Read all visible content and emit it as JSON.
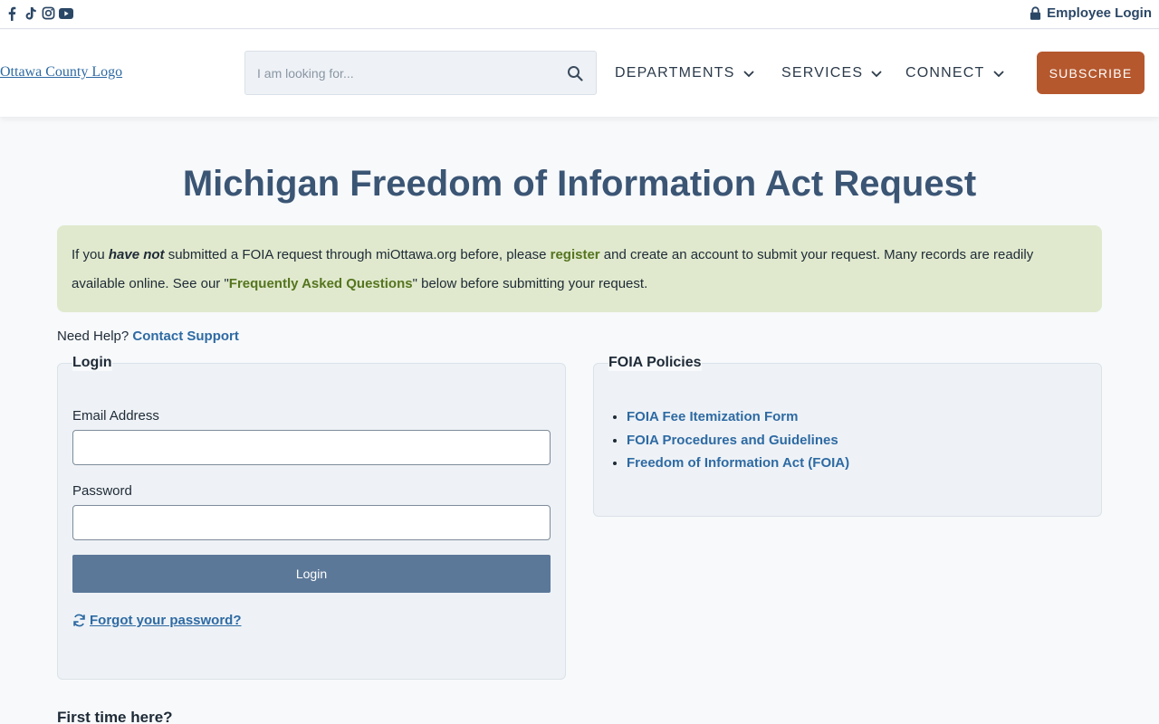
{
  "topbar": {
    "social": [
      {
        "icon": "facebook-icon"
      },
      {
        "icon": "tiktok-icon"
      },
      {
        "icon": "instagram-icon"
      },
      {
        "icon": "youtube-icon"
      }
    ],
    "employee_login": "Employee Login"
  },
  "header": {
    "logo_alt": "Ottawa County Logo",
    "search_placeholder": "I am looking for...",
    "nav": {
      "departments": "DEPARTMENTS",
      "services": "SERVICES",
      "connect": "CONNECT"
    },
    "subscribe": "SUBSCRIBE"
  },
  "page": {
    "title": "Michigan Freedom of Information Act Request"
  },
  "notice": {
    "part1": "If you ",
    "emphasis": "have not",
    "part2": " submitted a FOIA request through miOttawa.org before, please ",
    "register_link": "register",
    "part3": " and create an account to submit your request. Many records are readily available online. See our \"",
    "faq_link": "Frequently Asked Questions",
    "part4": "\" below before submitting your request."
  },
  "help": {
    "text": "Need Help?",
    "link": "Contact Support"
  },
  "login": {
    "legend": "Login",
    "email_label": "Email Address",
    "email_value": "",
    "password_label": "Password",
    "password_value": "",
    "button": "Login",
    "forgot": "Forgot your password?"
  },
  "policies": {
    "legend": "FOIA Policies",
    "items": [
      "FOIA Fee Itemization Form",
      "FOIA Procedures and Guidelines",
      "Freedom of Information Act (FOIA)"
    ]
  },
  "first_time": "First time here?",
  "colors": {
    "accent": "#b5582e",
    "title": "#3b5574",
    "notice_bg": "#e0e9cd",
    "button": "#5c7899"
  }
}
